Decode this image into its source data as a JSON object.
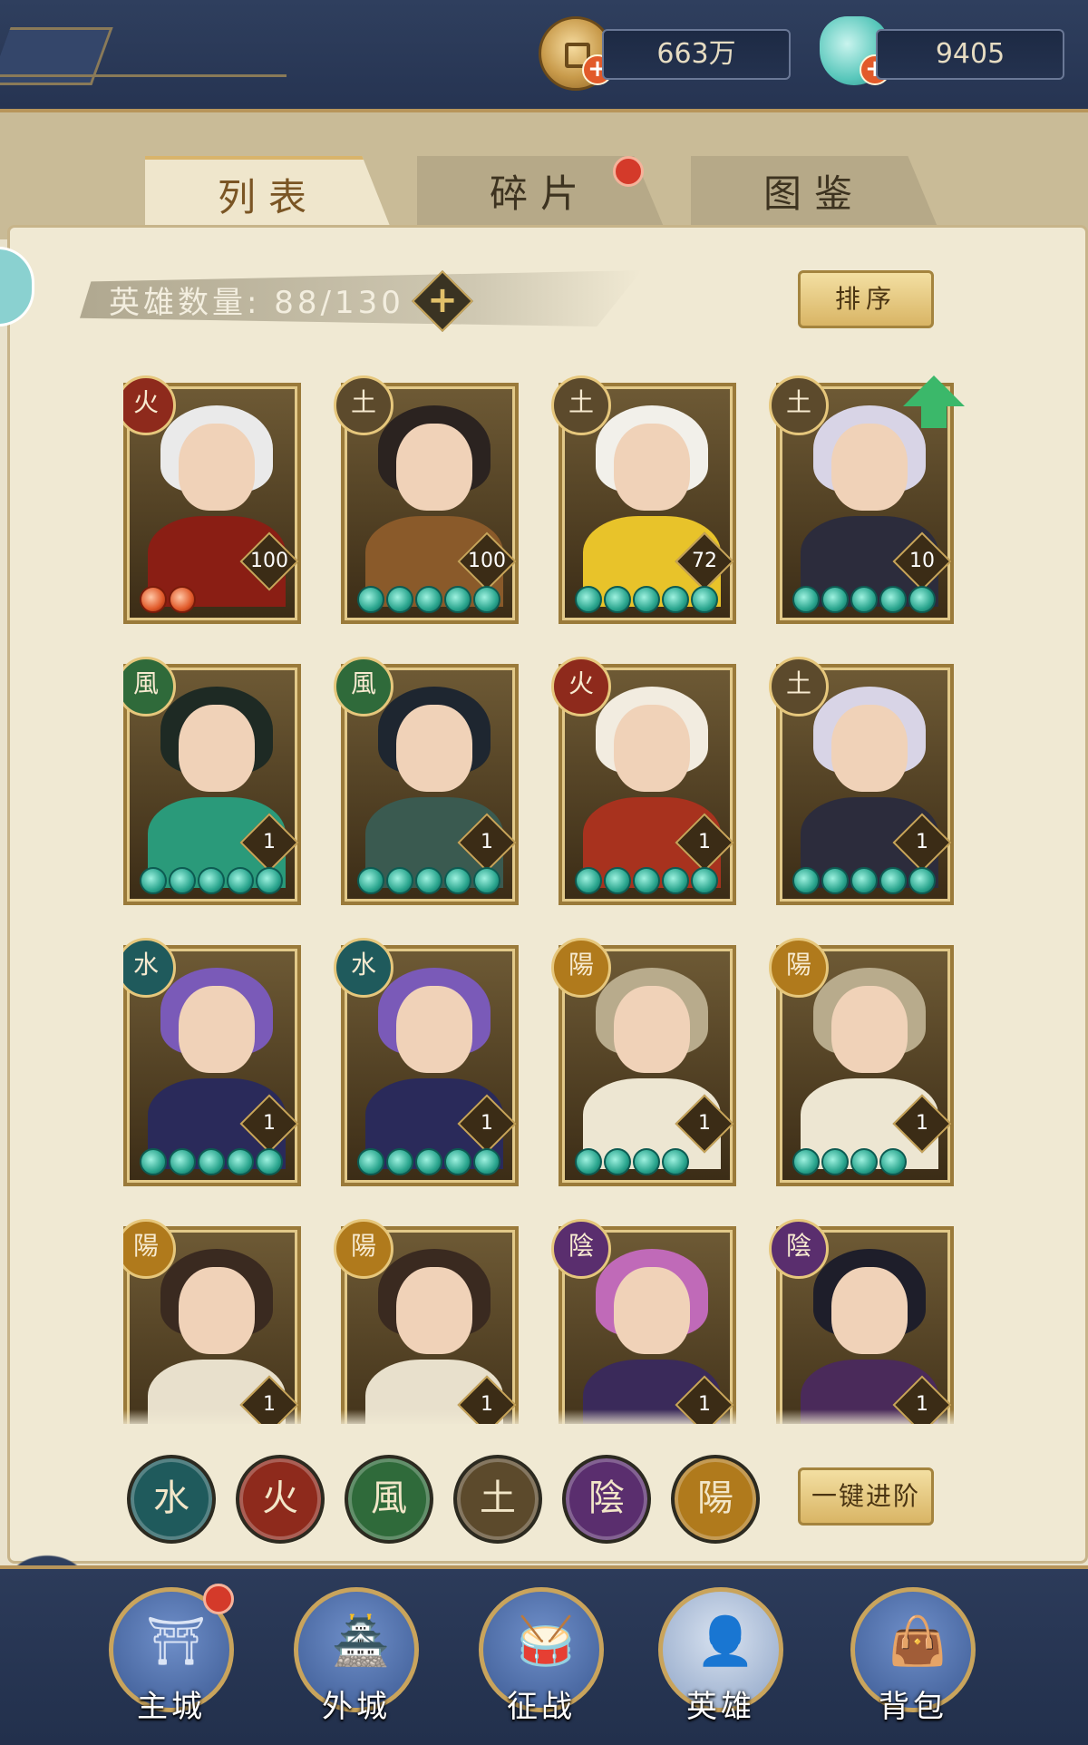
{
  "resources": {
    "coins": "663万",
    "shells": "9405"
  },
  "tabs": [
    {
      "label": "列表",
      "active": true
    },
    {
      "label": "碎片",
      "active": false,
      "has_notification": true
    },
    {
      "label": "图鉴",
      "active": false
    }
  ],
  "hero_count": {
    "label": "英雄数量:",
    "value": "88/130"
  },
  "sort_button": "排序",
  "heroes": [
    {
      "element": "火",
      "level": "100",
      "stars": 2,
      "star_type": "red",
      "hair": "#eaeaea",
      "outfit": "#8a1e14"
    },
    {
      "element": "土",
      "level": "100",
      "stars": 5,
      "star_type": "teal",
      "hair": "#2b2320",
      "outfit": "#8a5a2a"
    },
    {
      "element": "土",
      "level": "72",
      "stars": 5,
      "star_type": "teal",
      "hair": "#f2f0ea",
      "outfit": "#e8c32a"
    },
    {
      "element": "土",
      "level": "10",
      "stars": 5,
      "star_type": "teal",
      "hair": "#d8d4e6",
      "outfit": "#2c2c3c",
      "upgrade": true
    },
    {
      "element": "風",
      "level": "1",
      "stars": 5,
      "star_type": "teal",
      "hair": "#1e2a24",
      "outfit": "#2a9a7a"
    },
    {
      "element": "風",
      "level": "1",
      "stars": 5,
      "star_type": "teal",
      "hair": "#1e2630",
      "outfit": "#3a5a50"
    },
    {
      "element": "火",
      "level": "1",
      "stars": 5,
      "star_type": "teal",
      "hair": "#f2ece0",
      "outfit": "#a8321e"
    },
    {
      "element": "土",
      "level": "1",
      "stars": 5,
      "star_type": "teal",
      "hair": "#d8d4e6",
      "outfit": "#2c2c3c"
    },
    {
      "element": "水",
      "level": "1",
      "stars": 5,
      "star_type": "teal",
      "hair": "#7a5ab8",
      "outfit": "#2a2a5a"
    },
    {
      "element": "水",
      "level": "1",
      "stars": 5,
      "star_type": "teal",
      "hair": "#7a5ab8",
      "outfit": "#2a2a5a"
    },
    {
      "element": "陽",
      "level": "1",
      "stars": 4,
      "star_type": "teal",
      "hair": "#b8ab8c",
      "outfit": "#ede6d2"
    },
    {
      "element": "陽",
      "level": "1",
      "stars": 4,
      "star_type": "teal",
      "hair": "#b8ab8c",
      "outfit": "#ede6d2"
    },
    {
      "element": "陽",
      "level": "1",
      "stars": 0,
      "star_type": "teal",
      "hair": "#3a2a20",
      "outfit": "#e8e0cc"
    },
    {
      "element": "陽",
      "level": "1",
      "stars": 0,
      "star_type": "teal",
      "hair": "#3a2a20",
      "outfit": "#e8e0cc"
    },
    {
      "element": "陰",
      "level": "1",
      "stars": 0,
      "star_type": "teal",
      "hair": "#c06ab8",
      "outfit": "#3a2a5a"
    },
    {
      "element": "陰",
      "level": "1",
      "stars": 0,
      "star_type": "teal",
      "hair": "#1e1e2a",
      "outfit": "#4a2a5a"
    }
  ],
  "element_colors": {
    "水": "#1f5a5c",
    "火": "#8e2a1c",
    "風": "#2f6a3a",
    "土": "#5c4a2c",
    "陰": "#5a2e6e",
    "陽": "#b07a1c"
  },
  "element_filters": [
    "水",
    "火",
    "風",
    "土",
    "陰",
    "陽"
  ],
  "advance_button": "一键进阶",
  "nav": [
    {
      "label": "主城",
      "icon": "palace-icon",
      "glyph": "⛩",
      "notification": true
    },
    {
      "label": "外城",
      "icon": "city-gate-icon",
      "glyph": "🏯",
      "notification": false
    },
    {
      "label": "征战",
      "icon": "war-drum-icon",
      "glyph": "🥁",
      "notification": false
    },
    {
      "label": "英雄",
      "icon": "hero-portrait-icon",
      "glyph": "👤",
      "notification": false,
      "active": true
    },
    {
      "label": "背包",
      "icon": "bag-icon",
      "glyph": "👜",
      "notification": false
    }
  ]
}
